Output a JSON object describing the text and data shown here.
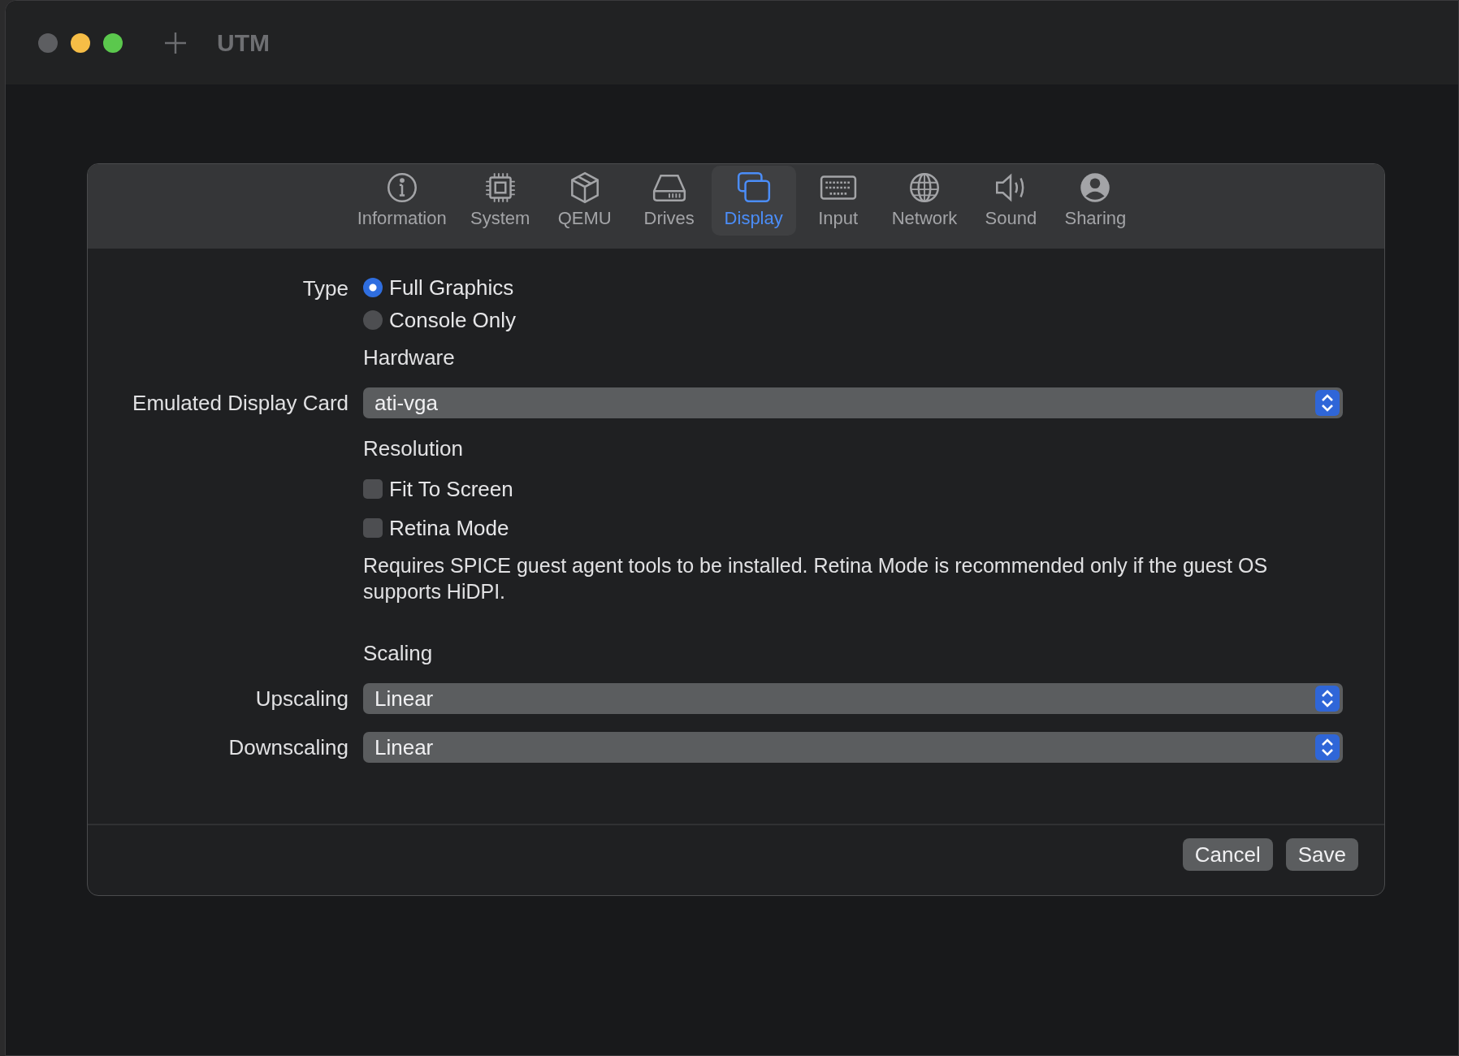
{
  "window": {
    "title": "UTM"
  },
  "tabs": [
    {
      "label": "Information",
      "kind": "info",
      "selected": false
    },
    {
      "label": "System",
      "kind": "chip",
      "selected": false
    },
    {
      "label": "QEMU",
      "kind": "box",
      "selected": false
    },
    {
      "label": "Drives",
      "kind": "drive",
      "selected": false
    },
    {
      "label": "Display",
      "kind": "display",
      "selected": true
    },
    {
      "label": "Input",
      "kind": "keyboard",
      "selected": false
    },
    {
      "label": "Network",
      "kind": "globe",
      "selected": false
    },
    {
      "label": "Sound",
      "kind": "speaker",
      "selected": false
    },
    {
      "label": "Sharing",
      "kind": "person",
      "selected": false
    }
  ],
  "rows": [
    {
      "kind": "radio",
      "label": "Type",
      "options": [
        {
          "label": "Full Graphics",
          "selected": true
        },
        {
          "label": "Console Only",
          "selected": false
        }
      ]
    },
    {
      "kind": "heading",
      "text": "Hardware"
    },
    {
      "kind": "select",
      "label": "Emulated Display Card",
      "value": "ati-vga"
    },
    {
      "kind": "heading",
      "text": "Resolution"
    },
    {
      "kind": "checkbox",
      "text": "Fit To Screen",
      "checked": false
    },
    {
      "kind": "checkbox",
      "text": "Retina Mode",
      "checked": false
    },
    {
      "kind": "note",
      "text": "Requires SPICE guest agent tools to be installed. Retina Mode is recommended only if the guest OS supports HiDPI."
    },
    {
      "kind": "heading",
      "text": "Scaling"
    },
    {
      "kind": "select",
      "label": "Upscaling",
      "value": "Linear"
    },
    {
      "kind": "select",
      "label": "Downscaling",
      "value": "Linear"
    }
  ],
  "buttons": [
    "Cancel",
    "Save"
  ]
}
